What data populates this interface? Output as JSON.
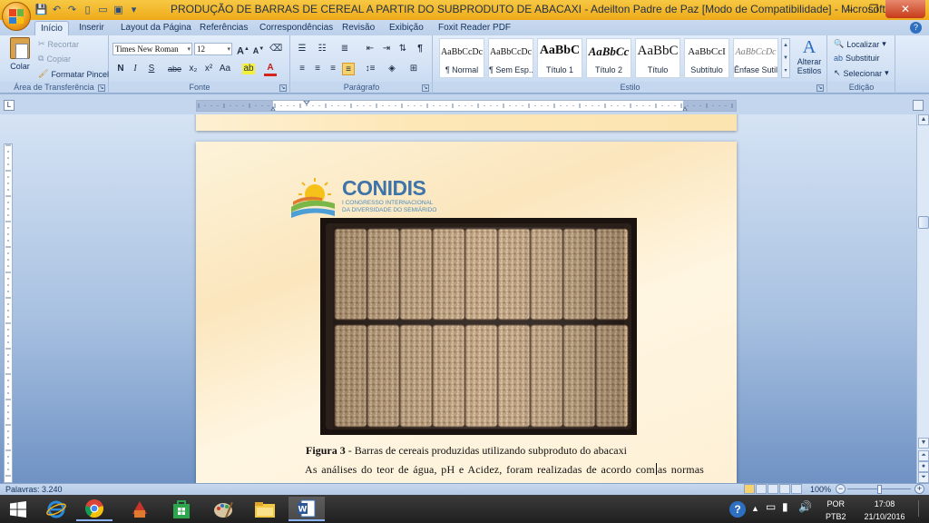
{
  "window": {
    "title": "PRODUÇÃO DE BARRAS DE CEREAL A PARTIR DO SUBPRODUTO DE ABACAXI - Adeilton Padre de Paz [Modo de Compatibilidade] - Microsoft Word",
    "minimize": "–",
    "maximize": "❐",
    "close": "✕"
  },
  "tabs": [
    "Início",
    "Inserir",
    "Layout da Página",
    "Referências",
    "Correspondências",
    "Revisão",
    "Exibição",
    "Foxit Reader PDF"
  ],
  "help": "?",
  "ribbon": {
    "clipboard": {
      "label": "Área de Transferência",
      "paste": "Colar",
      "cut": "Recortar",
      "copy": "Copiar",
      "format_painter": "Formatar Pincel"
    },
    "font": {
      "label": "Fonte",
      "font_name": "Times New Roman",
      "font_size": "12",
      "bold": "N",
      "italic": "I",
      "underline": "S",
      "strike": "abe",
      "subscript": "x₂",
      "superscript": "x²",
      "case": "Aa",
      "grow": "A",
      "shrink": "A"
    },
    "paragraph": {
      "label": "Parágrafo",
      "pilcrow": "¶"
    },
    "styles": {
      "label": "Estilo",
      "items": [
        {
          "sample": "AaBbCcDc",
          "name": "¶ Normal"
        },
        {
          "sample": "AaBbCcDc",
          "name": "¶ Sem Esp..."
        },
        {
          "sample": "AaBbC",
          "name": "Título 1"
        },
        {
          "sample": "AaBbCc",
          "name": "Título 2"
        },
        {
          "sample": "AaBbC",
          "name": "Título"
        },
        {
          "sample": "AaBbCcI",
          "name": "Subtítulo"
        },
        {
          "sample": "AaBbCcDc",
          "name": "Ênfase Sutil"
        }
      ],
      "change_styles": "Alterar Estilos"
    },
    "editing": {
      "label": "Edição",
      "find": "Localizar",
      "replace": "Substituir",
      "select": "Selecionar"
    }
  },
  "document": {
    "logo_word": "CONIDIS",
    "logo_sub": "I CONGRESSO INTERNACIONAL DA DIVERSIDADE DO SEMIÁRIDO",
    "caption_label": "Figura 3",
    "caption_text": " - Barras de cereais produzidas utilizando subproduto do abacaxi",
    "body_before_cursor": "As análises do teor de água, pH e Acidez, foram realizadas de acordo com",
    "body_after_cursor": "as normas"
  },
  "status": {
    "words": "Palavras: 3.240",
    "zoom": "100%"
  },
  "taskbar": {
    "lang": "POR",
    "layout": "PTB2",
    "time": "17:08",
    "date": "21/10/2016"
  },
  "colors": {
    "title_bar": "#eeaa1a",
    "ribbon": "#cfdff3",
    "page_bg": "#fbe6bd",
    "logo_blue": "#3f74a8"
  }
}
